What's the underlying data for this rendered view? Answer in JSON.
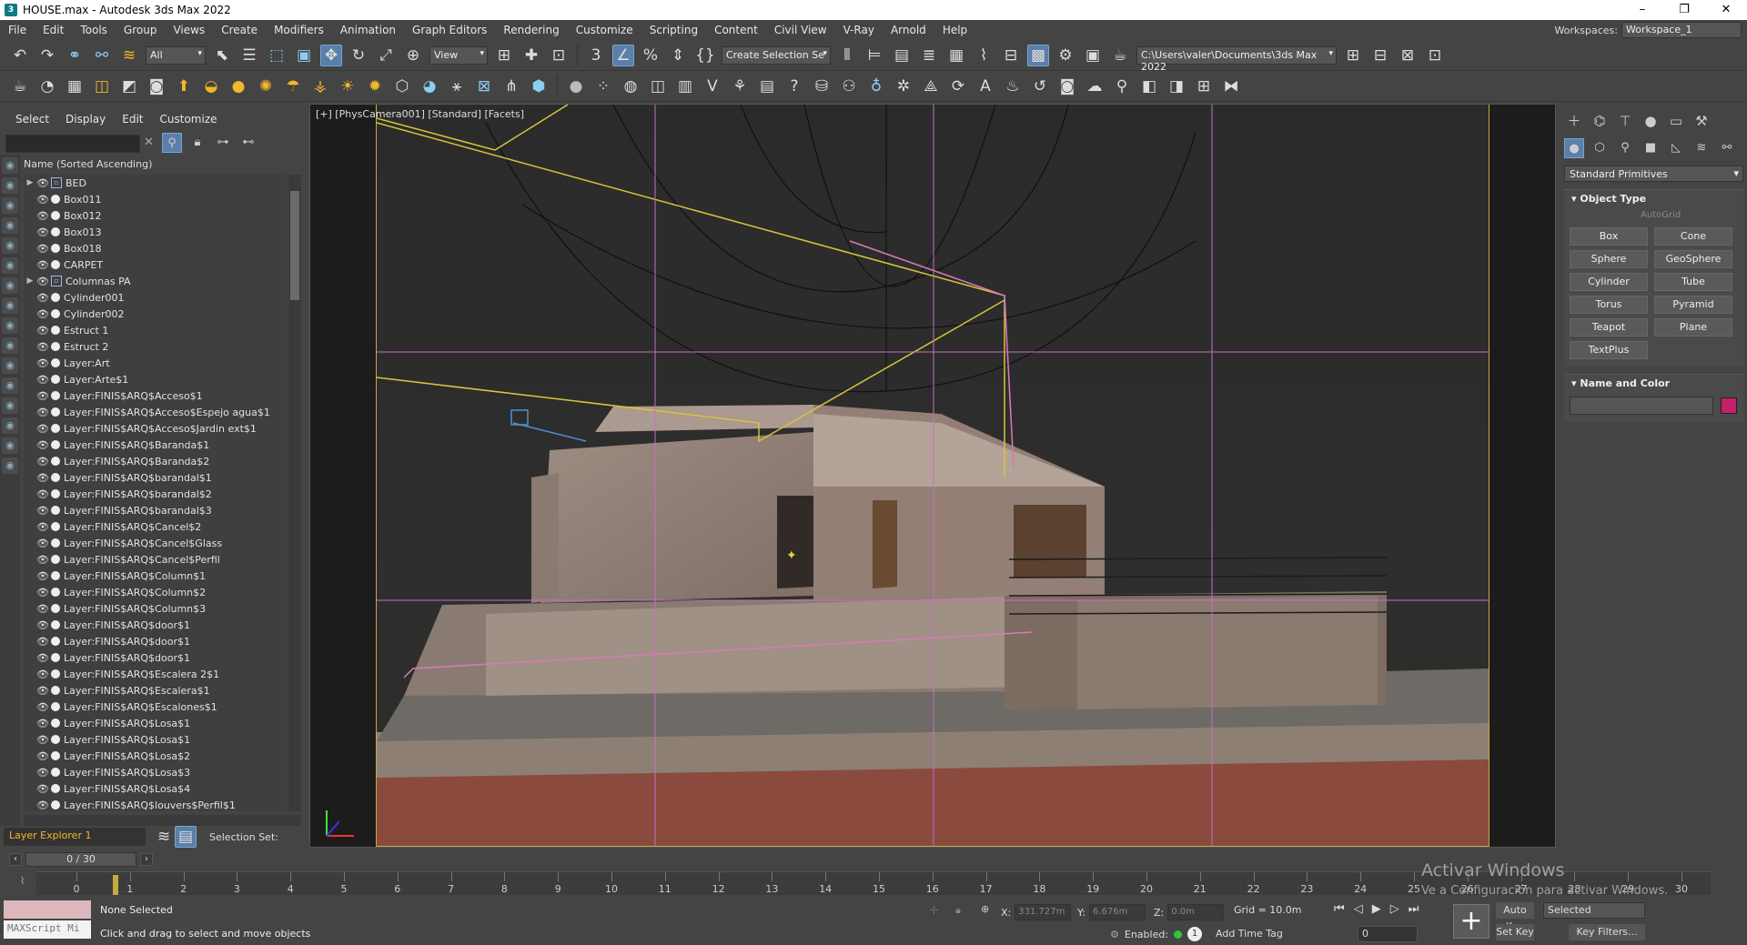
{
  "window": {
    "title": "HOUSE.max - Autodesk 3ds Max 2022",
    "min": "–",
    "restore": "❐",
    "close": "✕"
  },
  "menu": [
    "File",
    "Edit",
    "Tools",
    "Group",
    "Views",
    "Create",
    "Modifiers",
    "Animation",
    "Graph Editors",
    "Rendering",
    "Customize",
    "Scripting",
    "Content",
    "Civil View",
    "V-Ray",
    "Arnold",
    "Help"
  ],
  "workspaces": {
    "label": "Workspaces:",
    "value": "Workspace_1"
  },
  "toolbar": {
    "filter": "All",
    "refcoord": "View",
    "selection_set": "Create Selection Se",
    "path": "C:\\Users\\valer\\Documents\\3ds Max 2022"
  },
  "scene_explorer": {
    "tabs": [
      "Select",
      "Display",
      "Edit",
      "Customize"
    ],
    "column_header": "Name (Sorted Ascending)",
    "items": [
      {
        "name": "BED",
        "group": true
      },
      {
        "name": "Box011"
      },
      {
        "name": "Box012"
      },
      {
        "name": "Box013"
      },
      {
        "name": "Box018"
      },
      {
        "name": "CARPET"
      },
      {
        "name": "Columnas PA",
        "group": true
      },
      {
        "name": "Cylinder001"
      },
      {
        "name": "Cylinder002"
      },
      {
        "name": "Estruct 1"
      },
      {
        "name": "Estruct 2"
      },
      {
        "name": "Layer:Art"
      },
      {
        "name": "Layer:Arte$1"
      },
      {
        "name": "Layer:FINIS$ARQ$Acceso$1"
      },
      {
        "name": "Layer:FINIS$ARQ$Acceso$Espejo agua$1"
      },
      {
        "name": "Layer:FINIS$ARQ$Acceso$Jardin ext$1"
      },
      {
        "name": "Layer:FINIS$ARQ$Baranda$1"
      },
      {
        "name": "Layer:FINIS$ARQ$Baranda$2"
      },
      {
        "name": "Layer:FINIS$ARQ$barandal$1"
      },
      {
        "name": "Layer:FINIS$ARQ$barandal$2"
      },
      {
        "name": "Layer:FINIS$ARQ$barandal$3"
      },
      {
        "name": "Layer:FINIS$ARQ$Cancel$2"
      },
      {
        "name": "Layer:FINIS$ARQ$Cancel$Glass"
      },
      {
        "name": "Layer:FINIS$ARQ$Cancel$Perfil"
      },
      {
        "name": "Layer:FINIS$ARQ$Column$1"
      },
      {
        "name": "Layer:FINIS$ARQ$Column$2"
      },
      {
        "name": "Layer:FINIS$ARQ$Column$3"
      },
      {
        "name": "Layer:FINIS$ARQ$door$1"
      },
      {
        "name": "Layer:FINIS$ARQ$door$1"
      },
      {
        "name": "Layer:FINIS$ARQ$door$1"
      },
      {
        "name": "Layer:FINIS$ARQ$Escalera 2$1"
      },
      {
        "name": "Layer:FINIS$ARQ$Escalera$1"
      },
      {
        "name": "Layer:FINIS$ARQ$Escalones$1"
      },
      {
        "name": "Layer:FINIS$ARQ$Losa$1"
      },
      {
        "name": "Layer:FINIS$ARQ$Losa$1"
      },
      {
        "name": "Layer:FINIS$ARQ$Losa$2"
      },
      {
        "name": "Layer:FINIS$ARQ$Losa$3"
      },
      {
        "name": "Layer:FINIS$ARQ$Losa$4"
      },
      {
        "name": "Layer:FINIS$ARQ$louvers$Perfil$1"
      }
    ],
    "layer_explorer": "Layer Explorer 1",
    "selection_set_label": "Selection Set:"
  },
  "viewport": {
    "label": "[+] [PhysCamera001] [Standard] [Facets]"
  },
  "command_panel": {
    "dropdown": "Standard Primitives",
    "object_type_title": "Object Type",
    "autogrid": "AutoGrid",
    "primitives": [
      "Box",
      "Cone",
      "Sphere",
      "GeoSphere",
      "Cylinder",
      "Tube",
      "Torus",
      "Pyramid",
      "Teapot",
      "Plane",
      "TextPlus"
    ],
    "name_color_title": "Name and Color",
    "color": "#c61f6b"
  },
  "timeslider": {
    "value": "0 / 30"
  },
  "timeline": {
    "ticks": [
      "0",
      "1",
      "2",
      "3",
      "4",
      "5",
      "6",
      "7",
      "8",
      "9",
      "10",
      "11",
      "12",
      "13",
      "14",
      "15",
      "16",
      "17",
      "18",
      "19",
      "20",
      "21",
      "22",
      "23",
      "24",
      "25",
      "26",
      "27",
      "28",
      "29",
      "30"
    ]
  },
  "status": {
    "maxscript": "MAXScript Mi",
    "none_selected": "None Selected",
    "prompt": "Click and drag to select and move objects",
    "x_label": "X:",
    "x_value": "331.727m",
    "y_label": "Y:",
    "y_value": "6.676m",
    "z_label": "Z:",
    "z_value": "0.0m",
    "grid": "Grid = 10.0m",
    "enabled": "Enabled:",
    "enabled_count": "1",
    "add_time_tag": "Add Time Tag",
    "frame": "0",
    "autokey": "Auto Key",
    "setkey": "Set Key",
    "selected": "Selected",
    "keyfilters": "Key Filters..."
  },
  "watermark": {
    "line1": "Activar Windows",
    "line2": "Ve a Configuración para activar Windows."
  }
}
